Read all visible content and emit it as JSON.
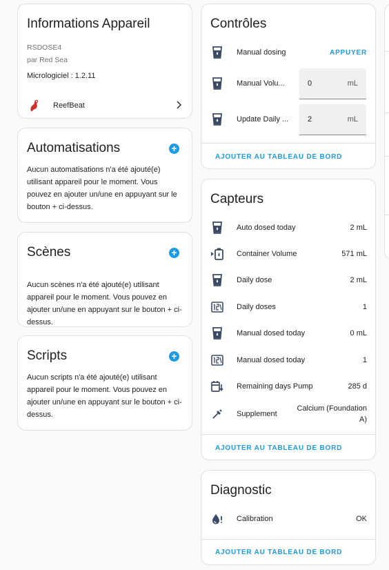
{
  "device_info": {
    "title": "Informations Appareil",
    "model": "RSDOSE4",
    "manufacturer": "par Red Sea",
    "firmware": "Micrologiciel : 1.2.11",
    "integration": "ReefBeat",
    "integration_icon": "reefbeat-logo-icon"
  },
  "automations": {
    "title": "Automatisations",
    "description": "Aucun automatisations n'a été ajouté(e) utilisant appareil pour le moment. Vous pouvez en ajouter un/une en appuyant sur le bouton + ci-dessus."
  },
  "scenes": {
    "title": "Scènes",
    "description": "Aucun scènes n'a été ajouté(e) utilisant appareil pour le moment. Vous pouvez en ajouter un/une en appuyant sur le bouton + ci-dessus."
  },
  "scripts": {
    "title": "Scripts",
    "description": "Aucun scripts n'a été ajouté(e) utilisant appareil pour le moment. Vous pouvez en ajouter un/une en appuyant sur le bouton + ci-dessus."
  },
  "controls": {
    "title": "Contrôles",
    "rows": [
      {
        "icon": "dosing-cup-icon",
        "label": "Manual dosing",
        "action": "APPUYER"
      },
      {
        "icon": "dosing-cup-icon",
        "label": "Manual Volu...",
        "value": "0",
        "unit": "mL"
      },
      {
        "icon": "dosing-cup-icon",
        "label": "Update Daily ...",
        "value": "2",
        "unit": "mL"
      }
    ],
    "footer_action": "AJOUTER AU TABLEAU DE BORD"
  },
  "sensors": {
    "title": "Capteurs",
    "rows": [
      {
        "icon": "dosing-cup-icon",
        "label": "Auto dosed today",
        "value": "2 mL"
      },
      {
        "icon": "container-icon",
        "label": "Container Volume",
        "value": "571 mL"
      },
      {
        "icon": "dosing-cup-icon",
        "label": "Daily dose",
        "value": "2 mL"
      },
      {
        "icon": "counter-icon",
        "label": "Daily doses",
        "value": "1"
      },
      {
        "icon": "dosing-cup-icon",
        "label": "Manual dosed today",
        "value": "0 mL"
      },
      {
        "icon": "counter-icon",
        "label": "Manual dosed today",
        "value": "1"
      },
      {
        "icon": "calendar-clock-icon",
        "label": "Remaining days Pump",
        "value": "285 d"
      },
      {
        "icon": "pipette-icon",
        "label": "Supplement",
        "value": "Calcium (Foundation A)"
      }
    ],
    "footer_action": "AJOUTER AU TABLEAU DE BORD"
  },
  "diagnostic": {
    "title": "Diagnostic",
    "rows": [
      {
        "icon": "water-alert-icon",
        "label": "Calibration",
        "value": "OK"
      }
    ],
    "footer_action": "AJOUTER AU TABLEAU DE BORD"
  },
  "colors": {
    "accent": "#1a9be6",
    "icon": "#3b4a66",
    "reefbeat_red": "#d32f2f"
  }
}
